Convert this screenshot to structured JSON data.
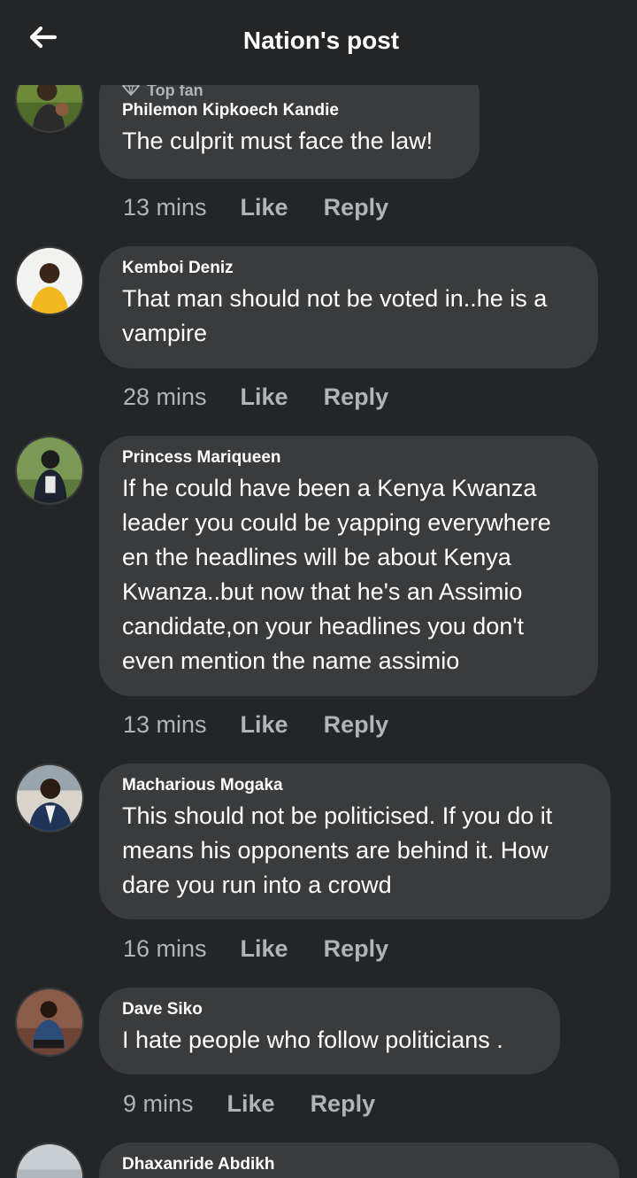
{
  "header": {
    "title": "Nation's post",
    "back_icon": "arrow-left-icon"
  },
  "comments": [
    {
      "badge": "Top fan",
      "author": "Philemon Kipkoech Kandie",
      "lines": [
        "The culprit must face the law!"
      ],
      "time": "13 mins",
      "like": "Like",
      "reply": "Reply"
    },
    {
      "author": "Kemboi Deniz",
      "lines": [
        "That man should not be voted in..he is a",
        "vampire"
      ],
      "time": "28 mins",
      "like": "Like",
      "reply": "Reply"
    },
    {
      "author": "Princess Mariqueen",
      "lines": [
        "If he could have been a Kenya Kwanza",
        "leader you could be yapping everywhere",
        "en the headlines will be about Kenya",
        "Kwanza..but now that he's an Assimio",
        "candidate,on your headlines you don't",
        "even mention the name assimio"
      ],
      "time": "13 mins",
      "like": "Like",
      "reply": "Reply"
    },
    {
      "author": "Macharious Mogaka",
      "lines": [
        "This should not be politicised. If you do it",
        "means his opponents are behind it. How",
        "dare you run into a crowd"
      ],
      "time": "16 mins",
      "like": "Like",
      "reply": "Reply"
    },
    {
      "author": "Dave Siko",
      "lines": [
        "I hate people who follow politicians ."
      ],
      "time": "9 mins",
      "like": "Like",
      "reply": "Reply"
    },
    {
      "author": "Dhaxanride Abdikh",
      "lines": []
    }
  ],
  "colors": {
    "background": "#242526",
    "bubble": "#3a3b3c",
    "muted": "#b0b3b8",
    "text": "#ffffff"
  }
}
